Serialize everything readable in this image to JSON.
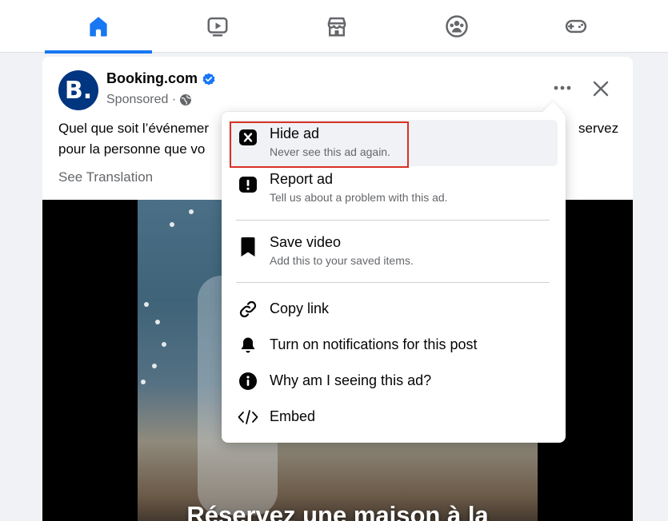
{
  "nav": {
    "tabs": [
      {
        "icon": "home-icon",
        "active": true
      },
      {
        "icon": "video-icon",
        "active": false
      },
      {
        "icon": "marketplace-icon",
        "active": false
      },
      {
        "icon": "groups-icon",
        "active": false
      },
      {
        "icon": "gaming-icon",
        "active": false
      }
    ],
    "accent": "#1877f2"
  },
  "post": {
    "avatar_letter": "B.",
    "author": "Booking.com",
    "sponsored": "Sponsored ·",
    "caption_line1": "Quel que soit l’événemer",
    "caption_line1_end": "servez",
    "caption_line2": "pour la personne que vo",
    "see_translation": "See Translation",
    "video_overlay_text": "Réservez une maison à la"
  },
  "menu": {
    "hide_ad": {
      "label": "Hide ad",
      "sub": "Never see this ad again."
    },
    "report_ad": {
      "label": "Report ad",
      "sub": "Tell us about a problem with this ad."
    },
    "save_video": {
      "label": "Save video",
      "sub": "Add this to your saved items."
    },
    "copy_link": {
      "label": "Copy link"
    },
    "notifications": {
      "label": "Turn on notifications for this post"
    },
    "why_ad": {
      "label": "Why am I seeing this ad?"
    },
    "embed": {
      "label": "Embed"
    }
  },
  "colors": {
    "brand_blue": "#1877f2",
    "booking_blue": "#003580",
    "highlight_red": "#d93025"
  }
}
